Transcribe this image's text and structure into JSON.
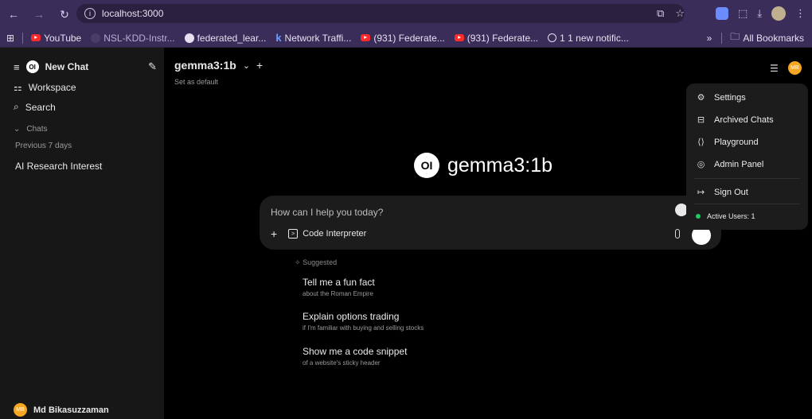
{
  "browser": {
    "url": "localhost:3000",
    "bookmarks": [
      {
        "label": "YouTube",
        "icon": "youtube-icon"
      },
      {
        "label": "NSL-KDD-Instr...",
        "icon": "github-icon"
      },
      {
        "label": "federated_lear...",
        "icon": "github-icon"
      },
      {
        "label": "Network Traffi...",
        "icon": "k-icon"
      },
      {
        "label": "(931) Federate...",
        "icon": "youtube-icon"
      },
      {
        "label": "(931) Federate...",
        "icon": "youtube-icon"
      },
      {
        "label": "1 1 new notific...",
        "icon": "globe-icon"
      }
    ],
    "more": "»",
    "all_bookmarks": "All Bookmarks"
  },
  "sidebar": {
    "new_chat": "New Chat",
    "workspace": "Workspace",
    "search": "Search",
    "chats_header": "Chats",
    "previous_7_days": "Previous 7 days",
    "chat_items": [
      "AI Research Interest"
    ],
    "user_name": "Md Bikasuzzaman",
    "user_initials": "MB"
  },
  "main": {
    "model": "gemma3:1b",
    "set_default": "Set as default",
    "hero_model": "gemma3:1b",
    "logo_text": "OI",
    "input_placeholder": "How can I help you today?",
    "code_interpreter": "Code Interpreter",
    "suggested_label": "Suggested",
    "suggestions": [
      {
        "title": "Tell me a fun fact",
        "sub": "about the Roman Empire"
      },
      {
        "title": "Explain options trading",
        "sub": "if I'm familiar with buying and selling stocks"
      },
      {
        "title": "Show me a code snippet",
        "sub": "of a website's sticky header"
      }
    ]
  },
  "user_menu": {
    "items": [
      "Settings",
      "Archived Chats",
      "Playground",
      "Admin Panel"
    ],
    "sign_out": "Sign Out",
    "active_users": "Active Users: 1"
  },
  "colors": {
    "accent": "#f5a623",
    "online": "#22c55e",
    "browser_bar": "#3b2d5a"
  }
}
